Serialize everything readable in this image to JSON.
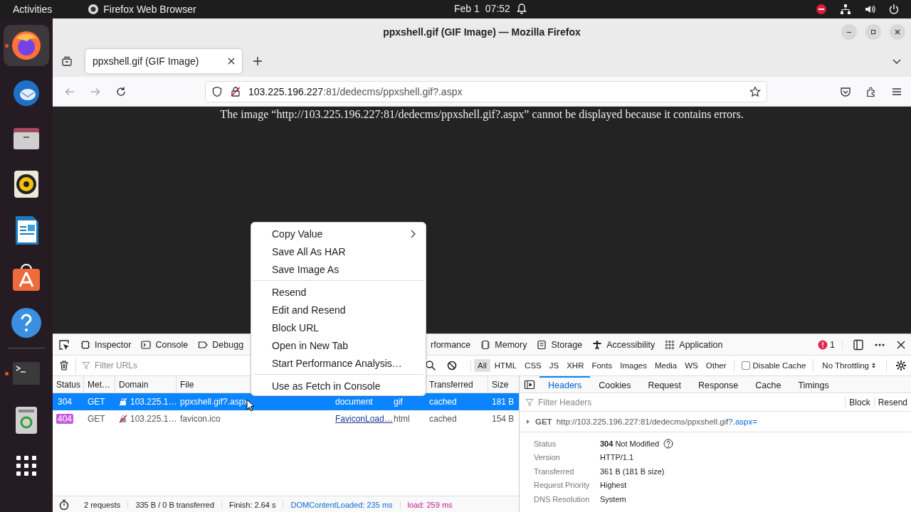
{
  "topbar": {
    "activities": "Activities",
    "app": "Firefox Web Browser",
    "date": "Feb 1",
    "time": "07:52"
  },
  "dock": [
    {
      "kind": "firefox",
      "running": true,
      "focused": true
    },
    {
      "kind": "mail",
      "running": false,
      "focused": false
    },
    {
      "kind": "files",
      "running": false,
      "focused": false
    },
    {
      "kind": "speaker",
      "running": false,
      "focused": false
    },
    {
      "kind": "document",
      "running": false,
      "focused": false
    },
    {
      "kind": "store",
      "running": false,
      "focused": false
    },
    {
      "kind": "help",
      "running": false,
      "focused": false
    },
    {
      "kind": "terminal",
      "running": true,
      "focused": false
    },
    {
      "kind": "trash",
      "running": false,
      "focused": false
    },
    {
      "kind": "apps",
      "running": false,
      "focused": false
    }
  ],
  "window": {
    "title": "ppxshell.gif (GIF Image) — Mozilla Firefox",
    "tabs": [
      {
        "label": "ppxshell.gif (GIF Image)",
        "selected": true
      }
    ],
    "url": {
      "host": "103.225.196.227",
      "rest": ":81/dedecms/ppxshell.gif?.aspx"
    }
  },
  "page": {
    "message": "The image “http://103.225.196.227:81/dedecms/ppxshell.gif?.aspx” cannot be displayed because it contains errors."
  },
  "devtools": {
    "tools": [
      {
        "label": "Inspector",
        "kind": "inspector"
      },
      {
        "label": "Console",
        "kind": "console"
      },
      {
        "label": "Debugg",
        "kind": "debugger"
      }
    ],
    "tools_right": [
      {
        "label": "rformance",
        "kind": "none"
      },
      {
        "label": "Memory",
        "kind": "memory"
      },
      {
        "label": "Storage",
        "kind": "storage"
      },
      {
        "label": "Accessibility",
        "kind": "accessibility"
      },
      {
        "label": "Application",
        "kind": "application"
      }
    ],
    "error_count": "1",
    "filter_placeholder": "Filter URLs",
    "type_filters": [
      {
        "label": "All",
        "selected": true
      },
      {
        "label": "HTML",
        "selected": false
      },
      {
        "label": "CSS",
        "selected": false
      },
      {
        "label": "JS",
        "selected": false
      },
      {
        "label": "XHR",
        "selected": false
      },
      {
        "label": "Fonts",
        "selected": false
      },
      {
        "label": "Images",
        "selected": false
      },
      {
        "label": "Media",
        "selected": false
      },
      {
        "label": "WS",
        "selected": false
      },
      {
        "label": "Other",
        "selected": false
      }
    ],
    "disable_cache": {
      "label": "Disable Cache",
      "checked": false
    },
    "throttling": "No Throttling",
    "columns": {
      "status": "Status",
      "method": "Met…",
      "domain": "Domain",
      "file": "File",
      "transferred": "Transferred",
      "size": "Size"
    },
    "rows": [
      {
        "status": "304",
        "status_error": false,
        "method": "GET",
        "domain": "103.225.1…",
        "file": "ppxshell.gif?.aspx",
        "initiator": "document",
        "initiator_link": false,
        "type": "gif",
        "transferred": "cached",
        "size": "181 B",
        "selected": true
      },
      {
        "status": "404",
        "status_error": true,
        "method": "GET",
        "domain": "103.225.1…",
        "file": "favicon.ico",
        "initiator": "FaviconLoad…",
        "initiator_link": true,
        "type": "html",
        "transferred": "cached",
        "size": "154 B",
        "selected": false
      }
    ],
    "panel": {
      "tabs": [
        {
          "label": "Headers",
          "selected": true
        },
        {
          "label": "Cookies",
          "selected": false
        },
        {
          "label": "Request",
          "selected": false
        },
        {
          "label": "Response",
          "selected": false
        },
        {
          "label": "Cache",
          "selected": false
        },
        {
          "label": "Timings",
          "selected": false
        }
      ],
      "filter_placeholder": "Filter Headers",
      "actions": [
        "Block",
        "Resend"
      ],
      "request": {
        "method": "GET",
        "url": "http://103.225.196.227:81/dedecms/ppxshell.gif",
        "query": "?.aspx="
      },
      "fields": [
        {
          "label": "Status",
          "value": "**304** Not Modified",
          "help": true
        },
        {
          "label": "Version",
          "value": "HTTP/1.1",
          "help": false
        },
        {
          "label": "Transferred",
          "value": "361 B (181 B size)",
          "help": false
        },
        {
          "label": "Request Priority",
          "value": "Highest",
          "help": false
        },
        {
          "label": "DNS Resolution",
          "value": "System",
          "help": false
        }
      ]
    },
    "status_bar": {
      "requests": "2 requests",
      "transferred": "335 B / 0 B transferred",
      "finish": "Finish: 2.64 s",
      "dom_loaded": "DOMContentLoaded: 235 ms",
      "load": "load: 259 ms"
    }
  },
  "context_menu": [
    [
      {
        "label": "Copy Value",
        "submenu": true
      },
      {
        "label": "Save All As HAR",
        "submenu": false
      },
      {
        "label": "Save Image As",
        "submenu": false
      }
    ],
    [
      {
        "label": "Resend",
        "submenu": false
      },
      {
        "label": "Edit and Resend",
        "submenu": false
      },
      {
        "label": "Block URL",
        "submenu": false
      },
      {
        "label": "Open in New Tab",
        "submenu": false
      },
      {
        "label": "Start Performance Analysis…",
        "submenu": false
      }
    ],
    [
      {
        "label": "Use as Fetch in Console",
        "submenu": false
      }
    ]
  ]
}
